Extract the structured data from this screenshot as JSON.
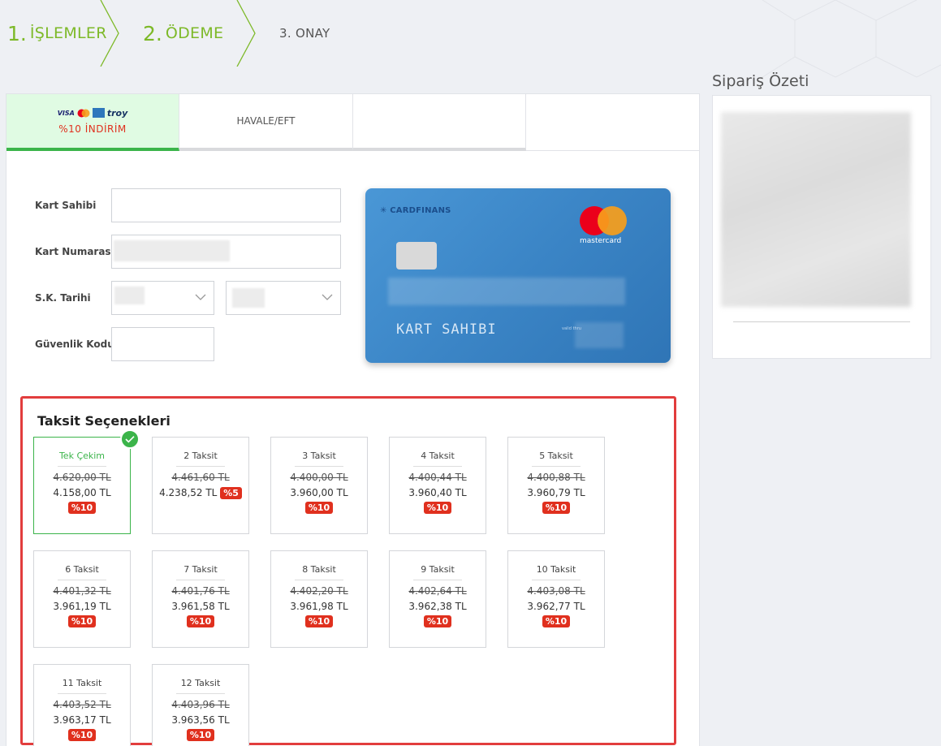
{
  "steps": [
    {
      "num": "1.",
      "label": "İŞLEMLER"
    },
    {
      "num": "2.",
      "label": "ÖDEME"
    },
    {
      "num": "",
      "label": "3. ONAY"
    }
  ],
  "tabs": {
    "card": {
      "logos": [
        "VISA",
        "mastercard",
        "amex",
        "troy"
      ],
      "discount": "%10 İNDİRİM"
    },
    "transfer": {
      "label": "HAVALE/EFT"
    },
    "empty": {
      "label": ""
    }
  },
  "form": {
    "holder_label": "Kart Sahibi",
    "number_label": "Kart Numarası",
    "expiry_label": "S.K. Tarihi",
    "cvv_label": "Güvenlik Kodu"
  },
  "card_preview": {
    "bank": "CARDFINANS",
    "brand": "mastercard",
    "holder": "KART SAHIBI",
    "valid_text": "valid thru"
  },
  "installments": {
    "title": "Taksit Seçenekleri",
    "options": [
      {
        "name": "Tek Çekim",
        "old": "4.620,00 TL",
        "new": "4.158,00 TL",
        "badge": "%10",
        "selected": true
      },
      {
        "name": "2 Taksit",
        "old": "4.461,60 TL",
        "new": "4.238,52 TL",
        "badge": "%5",
        "selected": false
      },
      {
        "name": "3 Taksit",
        "old": "4.400,00 TL",
        "new": "3.960,00 TL",
        "badge": "%10",
        "selected": false
      },
      {
        "name": "4 Taksit",
        "old": "4.400,44 TL",
        "new": "3.960,40 TL",
        "badge": "%10",
        "selected": false
      },
      {
        "name": "5 Taksit",
        "old": "4.400,88 TL",
        "new": "3.960,79 TL",
        "badge": "%10",
        "selected": false
      },
      {
        "name": "6 Taksit",
        "old": "4.401,32 TL",
        "new": "3.961,19 TL",
        "badge": "%10",
        "selected": false
      },
      {
        "name": "7 Taksit",
        "old": "4.401,76 TL",
        "new": "3.961,58 TL",
        "badge": "%10",
        "selected": false
      },
      {
        "name": "8 Taksit",
        "old": "4.402,20 TL",
        "new": "3.961,98 TL",
        "badge": "%10",
        "selected": false
      },
      {
        "name": "9 Taksit",
        "old": "4.402,64 TL",
        "new": "3.962,38 TL",
        "badge": "%10",
        "selected": false
      },
      {
        "name": "10 Taksit",
        "old": "4.403,08 TL",
        "new": "3.962,77 TL",
        "badge": "%10",
        "selected": false
      },
      {
        "name": "11 Taksit",
        "old": "4.403,52 TL",
        "new": "3.963,17 TL",
        "badge": "%10",
        "selected": false
      },
      {
        "name": "12 Taksit",
        "old": "4.403,96 TL",
        "new": "3.963,56 TL",
        "badge": "%10",
        "selected": false
      }
    ]
  },
  "summary": {
    "title": "Sipariş Özeti"
  },
  "colors": {
    "accent_green": "#7db928",
    "selected_green": "#3bb44a",
    "discount_red": "#e0301e",
    "highlight_border": "#e23d3d",
    "card_blue": "#3b85c6"
  }
}
